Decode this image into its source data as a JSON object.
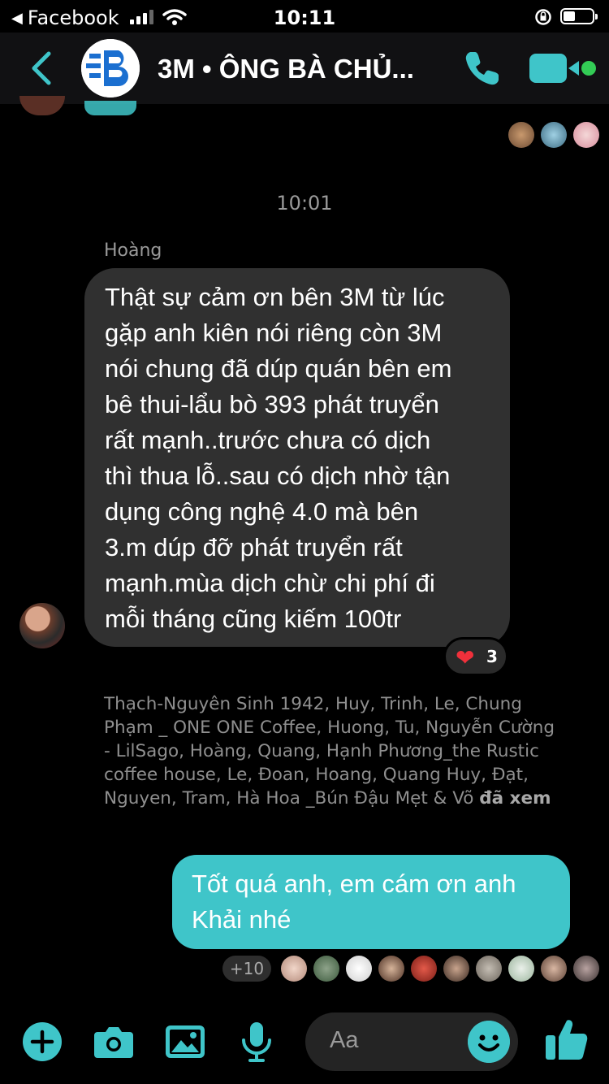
{
  "status_bar": {
    "back_app": "Facebook",
    "time": "10:11"
  },
  "header": {
    "title": "3M • ÔNG BÀ CHỦ...",
    "avatar_logo_text": "B"
  },
  "conversation": {
    "timestamp": "10:01",
    "incoming": {
      "sender": "Hoàng",
      "text": "Thật sự cảm ơn bên 3M từ lúc\ngặp anh kiên nói riêng còn 3M\nnói chung đã dúp quán bên em\nbê thui-lẩu bò 393 phát truyển\nrất mạnh..trước chưa có dịch\nthì thua lỗ..sau có dịch nhờ tận\ndụng công nghệ 4.0 mà bên\n3.m dúp đỡ phát truyển rất\nmạnh.mùa dịch chừ chi phí đi\nmỗi tháng cũng kiếm 100tr",
      "reaction_count": "3"
    },
    "seen_by_text": "Thạch-Nguyên Sinh 1942, Huy, Trinh, Le, Chung Phạm _ ONE ONE Coffee, Huong, Tu, Nguyễn Cường - LilSago, Hoàng, Quang, Hạnh Phương_the Rustic coffee house, Le, Đoan, Hoang, Quang Huy, Đạt, Nguyen, Tram, Hà Hoa _Bún Đậu Mẹt & Võ",
    "seen_by_suffix": "đã xem",
    "outgoing": {
      "text": "Tốt quá anh, em cám ơn anh\nKhải nhé"
    },
    "more_seen": "+10"
  },
  "composer": {
    "placeholder": "Aa"
  },
  "colors": {
    "accent": "#3fc5c9",
    "incoming_bubble": "#303030",
    "background": "#000000",
    "heart": "#f0303b"
  },
  "icons": [
    "back-arrow-icon",
    "phone-icon",
    "video-icon",
    "plus-icon",
    "camera-icon",
    "image-icon",
    "microphone-icon",
    "emoji-icon",
    "thumbs-up-icon",
    "heart-icon"
  ]
}
